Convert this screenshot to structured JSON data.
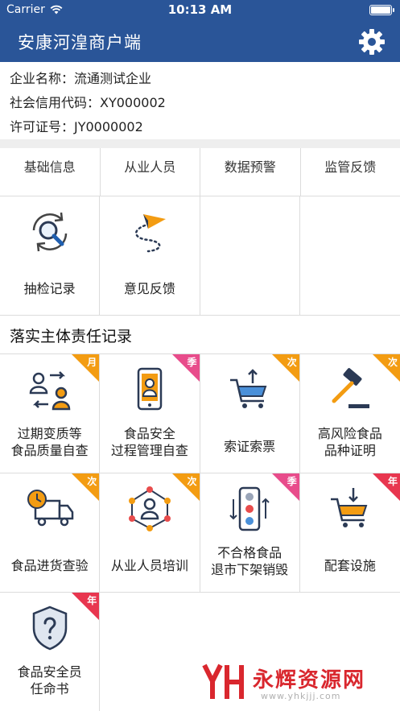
{
  "status": {
    "carrier": "Carrier",
    "time": "10:13 AM"
  },
  "nav": {
    "title": "安康河湟商户端"
  },
  "company": {
    "name_row": "企业名称：流通测试企业",
    "credit_row": "社会信用代码：XY000002",
    "license_row": "许可证号：JY0000002"
  },
  "tabs": [
    "基础信息",
    "从业人员",
    "数据预警",
    "监管反馈"
  ],
  "tools": [
    {
      "label": "抽检记录",
      "icon": "search-refresh-icon"
    },
    {
      "label": "意见反馈",
      "icon": "paper-plane-icon"
    }
  ],
  "section": {
    "title": "落实主体责任记录"
  },
  "records": [
    {
      "label": "过期变质等\n食品质量自查",
      "badge": "月",
      "badge_color": "#f39c12",
      "icon": "people-exchange-icon"
    },
    {
      "label": "食品安全\n过程管理自查",
      "badge": "季",
      "badge_color": "#e84c8b",
      "icon": "phone-person-icon"
    },
    {
      "label": "索证索票",
      "badge": "次",
      "badge_color": "#f39c12",
      "icon": "cart-upload-icon"
    },
    {
      "label": "高风险食品\n品种证明",
      "badge": "次",
      "badge_color": "#f39c12",
      "icon": "gavel-icon"
    },
    {
      "label": "食品进货查验",
      "badge": "次",
      "badge_color": "#f39c12",
      "icon": "truck-clock-icon"
    },
    {
      "label": "从业人员培训",
      "badge": "次",
      "badge_color": "#f39c12",
      "icon": "network-person-icon"
    },
    {
      "label": "不合格食品\n退市下架销毁",
      "badge": "季",
      "badge_color": "#e84c8b",
      "icon": "traffic-light-icon"
    },
    {
      "label": "配套设施",
      "badge": "年",
      "badge_color": "#e8364f",
      "icon": "cart-download-icon"
    },
    {
      "label": "食品安全员\n任命书",
      "badge": "年",
      "badge_color": "#e8364f",
      "icon": "shield-question-icon"
    }
  ],
  "watermark": {
    "text": "永辉资源网",
    "url": "www.yhkjjj.com"
  },
  "colors": {
    "primary": "#2a5598",
    "accent": "#f39c12",
    "dark": "#2b3a55"
  }
}
